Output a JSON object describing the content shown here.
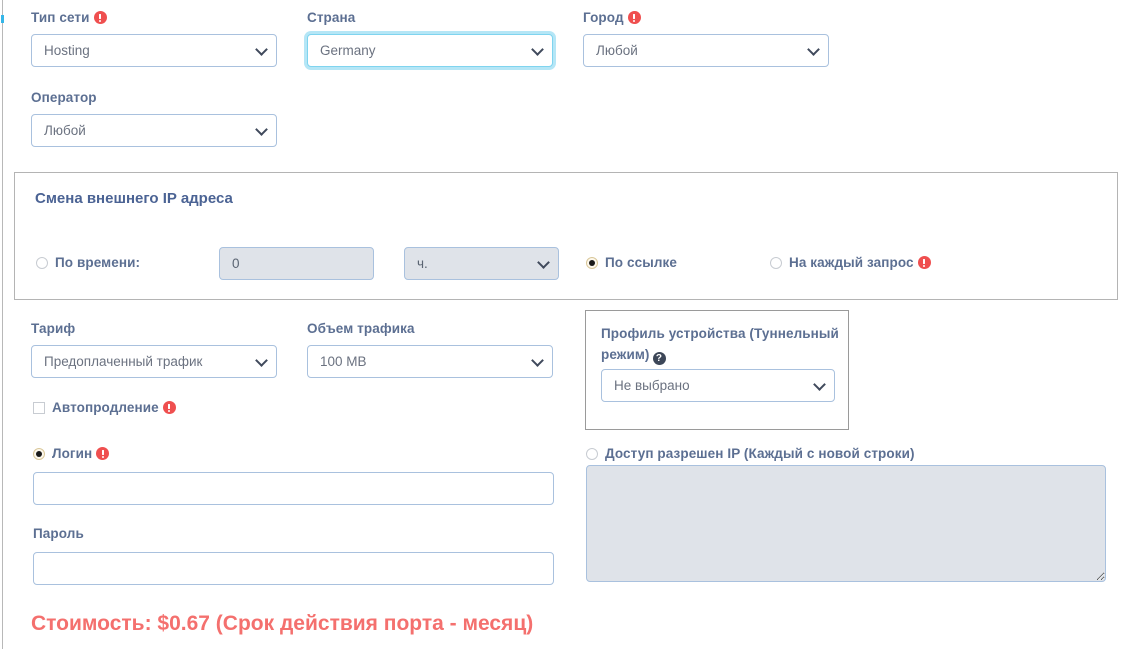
{
  "edge": {
    "accent_color": "#35b6e8",
    "rule_color": "#b8b8b8"
  },
  "colors": {
    "label": "#5c6f92",
    "panel_title": "#4b6394",
    "warning": "#ef4f4f",
    "price": "#f4706e",
    "focus_ring": "#7fd4ef",
    "select_border": "#a9c1de",
    "disabled_fill": "#dfe3e9"
  },
  "filters": {
    "network_type": {
      "label": "Тип сети",
      "required_icon": "warning-icon",
      "value": "Hosting"
    },
    "country": {
      "label": "Страна",
      "value": "Germany",
      "focused": true
    },
    "city": {
      "label": "Город",
      "required_icon": "warning-icon",
      "value": "Любой"
    },
    "operator": {
      "label": "Оператор",
      "value": "Любой"
    }
  },
  "ip_change_panel": {
    "title": "Смена внешнего IP адреса",
    "options": [
      {
        "id": "by-time",
        "label": "По времени:",
        "selected": false,
        "icon": null
      },
      {
        "id": "by-link",
        "label": "По ссылке",
        "selected": true,
        "icon": null
      },
      {
        "id": "each-request",
        "label": "На каждый запрос",
        "selected": false,
        "icon": "warning-icon"
      }
    ],
    "time_value": "0",
    "time_unit": "ч.",
    "time_disabled": true
  },
  "tariff": {
    "label": "Тариф",
    "value": "Предоплаченный трафик"
  },
  "traffic": {
    "label": "Объем трафика",
    "value": "100 MB"
  },
  "autorenew": {
    "label": "Автопродление",
    "checked": false,
    "required_icon": "warning-icon"
  },
  "device_profile": {
    "label_line1": "Профиль устройства (Туннельный",
    "label_line2": "режим)",
    "help_icon": "question-mark-icon",
    "help_glyph": "?",
    "value": "Не выбрано"
  },
  "auth": {
    "login_option": {
      "label": "Логин",
      "selected": true,
      "required_icon": "warning-icon"
    },
    "login_value": "",
    "login_placeholder": "",
    "password_label": "Пароль",
    "password_value": "",
    "password_placeholder": "",
    "ip_option": {
      "label": "Доступ разрешен IP (Каждый с новой строки)",
      "selected": false
    },
    "ip_list_value": "",
    "ip_list_placeholder": "",
    "ip_list_disabled": true
  },
  "price": {
    "text": "Стоимость: $0.67 (Срок действия порта - месяц)"
  }
}
